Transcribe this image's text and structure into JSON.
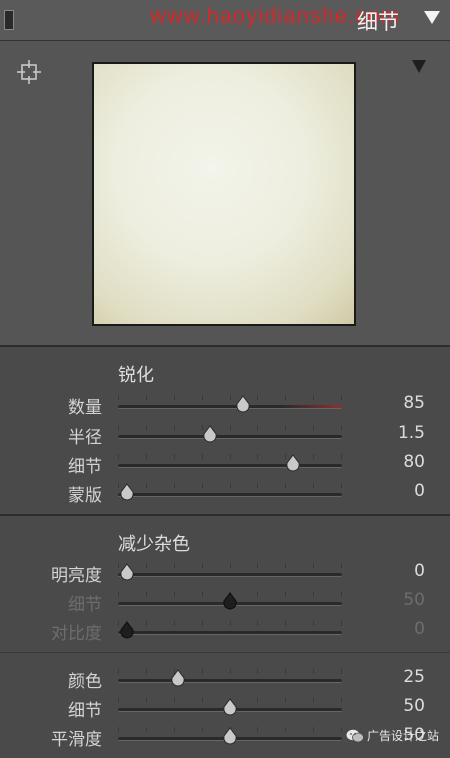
{
  "header": {
    "watermark": "www.haoyidianshe.com",
    "panel_title": "细节"
  },
  "sharpening": {
    "title": "锐化",
    "rows": [
      {
        "label": "数量",
        "value": "85",
        "position": 0.56,
        "dim": false,
        "highlight": true
      },
      {
        "label": "半径",
        "value": "1.5",
        "position": 0.41,
        "dim": false,
        "highlight": false
      },
      {
        "label": "细节",
        "value": "80",
        "position": 0.78,
        "dim": false,
        "highlight": false
      },
      {
        "label": "蒙版",
        "value": "0",
        "position": 0.04,
        "dim": false,
        "highlight": false
      }
    ]
  },
  "noise_reduction": {
    "title": "减少杂色",
    "rows": [
      {
        "label": "明亮度",
        "value": "0",
        "position": 0.04,
        "dim": false,
        "highlight": false
      },
      {
        "label": "细节",
        "value": "50",
        "position": 0.5,
        "dim": true,
        "highlight": false
      },
      {
        "label": "对比度",
        "value": "0",
        "position": 0.04,
        "dim": true,
        "highlight": false
      }
    ]
  },
  "color_noise": {
    "rows": [
      {
        "label": "颜色",
        "value": "25",
        "position": 0.27,
        "dim": false,
        "highlight": false
      },
      {
        "label": "细节",
        "value": "50",
        "position": 0.5,
        "dim": false,
        "highlight": false
      },
      {
        "label": "平滑度",
        "value": "50",
        "position": 0.5,
        "dim": false,
        "highlight": false
      }
    ]
  },
  "footer": {
    "badge_text": "广告设计之站"
  },
  "icons": {
    "target": "crosshair-target-icon",
    "collapse": "triangle-down-icon",
    "wechat": "wechat-icon"
  }
}
